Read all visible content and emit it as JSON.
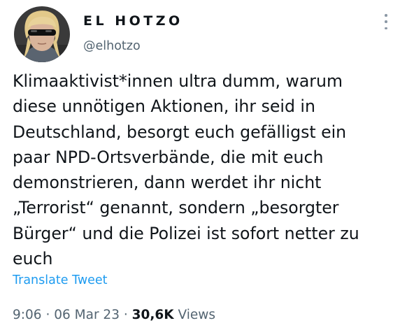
{
  "tweet": {
    "author": {
      "display_name": "EL HOTZO",
      "handle": "@elhotzo"
    },
    "text": "Klimaaktivist*innen ultra dumm, warum\ndiese unnötigen Aktionen, ihr seid in\nDeutschland, besorgt euch gefälligst ein\npaar NPD-Ortsverbände, die mit euch\ndemonstrieren, dann werdet ihr nicht\n„Terrorist“ genannt, sondern „besorgter\nBürger“ und die Polizei ist sofort netter zu\neuch",
    "translate_label": "Translate Tweet",
    "time": "9:06",
    "date": "06 Mar 23",
    "separator": "·",
    "views_count": "30,6K",
    "views_label": "Views"
  },
  "icons": {
    "more": "more-vertical-icon"
  },
  "colors": {
    "text": "#0f1419",
    "secondary": "#536471",
    "link": "#1d9bf0",
    "background": "#ffffff"
  }
}
